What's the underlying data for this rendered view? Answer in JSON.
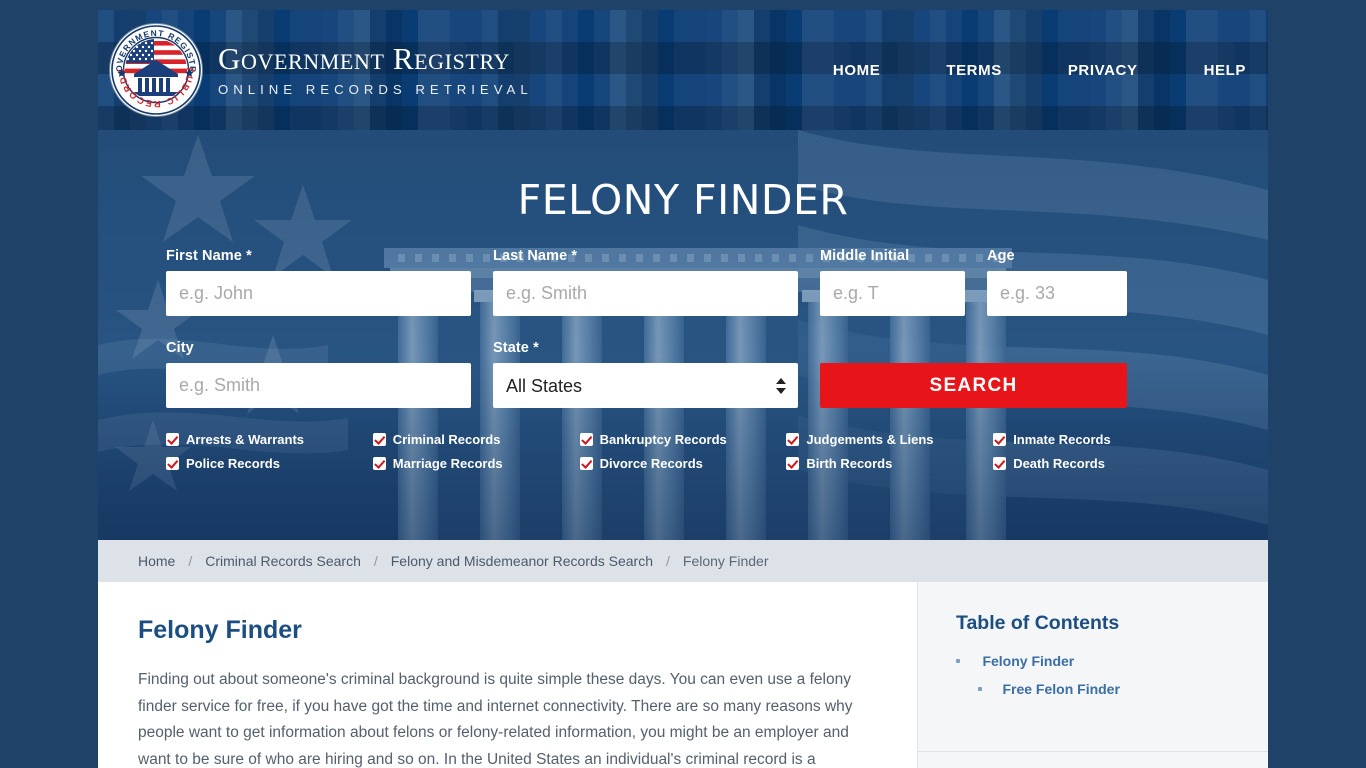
{
  "header": {
    "logo": {
      "icon": "government-registry-seal",
      "top_text": "GOVERNMENT REGISTRY",
      "bottom_text": "PUBLIC RECORDS"
    },
    "brand_title": "Government Registry",
    "brand_subtitle": "ONLINE RECORDS RETRIEVAL",
    "nav": [
      {
        "label": "HOME"
      },
      {
        "label": "TERMS"
      },
      {
        "label": "PRIVACY"
      },
      {
        "label": "HELP"
      }
    ]
  },
  "hero": {
    "title": "FELONY FINDER",
    "fields": {
      "first_name": {
        "label": "First Name *",
        "placeholder": "e.g. John",
        "value": ""
      },
      "last_name": {
        "label": "Last Name *",
        "placeholder": "e.g. Smith",
        "value": ""
      },
      "middle_initial": {
        "label": "Middle Initial",
        "placeholder": "e.g. T",
        "value": ""
      },
      "age": {
        "label": "Age",
        "placeholder": "e.g. 33",
        "value": ""
      },
      "city": {
        "label": "City",
        "placeholder": "e.g. Smith",
        "value": ""
      },
      "state": {
        "label": "State *",
        "selected": "All States",
        "options": [
          "All States"
        ]
      }
    },
    "search_button": "SEARCH",
    "checkboxes": [
      {
        "label": "Arrests & Warrants",
        "checked": true
      },
      {
        "label": "Criminal Records",
        "checked": true
      },
      {
        "label": "Bankruptcy Records",
        "checked": true
      },
      {
        "label": "Judgements & Liens",
        "checked": true
      },
      {
        "label": "Inmate Records",
        "checked": true
      },
      {
        "label": "Police Records",
        "checked": true
      },
      {
        "label": "Marriage Records",
        "checked": true
      },
      {
        "label": "Divorce Records",
        "checked": true
      },
      {
        "label": "Birth Records",
        "checked": true
      },
      {
        "label": "Death Records",
        "checked": true
      }
    ]
  },
  "breadcrumb": {
    "separator": "/",
    "items": [
      {
        "label": "Home"
      },
      {
        "label": "Criminal Records Search"
      },
      {
        "label": "Felony and Misdemeanor Records Search"
      },
      {
        "label": "Felony Finder"
      }
    ]
  },
  "main": {
    "heading": "Felony Finder",
    "paragraph": "Finding out about someone's criminal background is quite simple these days. You can even use a felony finder service for free, if you have got the time and internet connectivity. There are so many reasons why people want to get information about felons or felony-related information, you might be an employer and want to be sure of who are hiring and so on. In the United States an individual's criminal record is a"
  },
  "sidebar": {
    "heading": "Table of Contents",
    "items": [
      {
        "label": "Felony Finder",
        "children": [
          {
            "label": "Free Felon Finder"
          }
        ]
      }
    ]
  },
  "colors": {
    "page_background": "#1e4268",
    "header_blue": "#0a3c74",
    "accent_red": "#e7141a",
    "link_blue": "#1d4e82",
    "breadcrumb_bar": "#dde2e9",
    "sidebar_bg": "#f4f6f8"
  }
}
